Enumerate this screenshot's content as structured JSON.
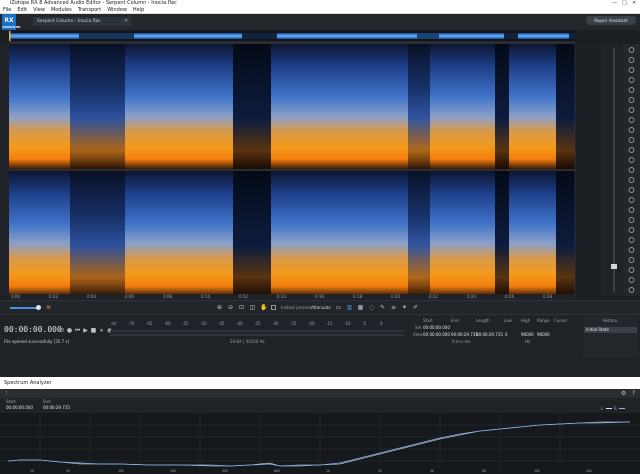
{
  "window": {
    "title": "iZotope RX 8 Advanced Audio Editor - Serpent Column - Inocia.flac",
    "minimize_glyph": "—",
    "maximize_glyph": "□",
    "close_glyph": "✕"
  },
  "menu": [
    "File",
    "Edit",
    "View",
    "Modules",
    "Transport",
    "Window",
    "Help"
  ],
  "logo": {
    "text": "RX",
    "sub": "ADVANCED"
  },
  "file_tab": {
    "label": "Serpent Column - Inocia.flac",
    "close": "✕"
  },
  "repair_assistant": {
    "label": "Repair Assistant"
  },
  "time_ruler": {
    "labels": [
      "0:00",
      "0:02",
      "0:04",
      "0:06",
      "0:08",
      "0:10",
      "0:12",
      "0:14",
      "0:16",
      "0:18",
      "0:20",
      "0:22",
      "0:24",
      "0:26",
      "0:28"
    ]
  },
  "toolbar2": {
    "instant_process": "Instant process",
    "mode": "Attenuate"
  },
  "transport": {
    "time": "00:00:00.000",
    "status": "File opened successfully [35.7 s]",
    "format": "24-bit | 44100 Hz",
    "format_label": "Sample rate",
    "meter_scale": [
      "-Inf",
      "-70",
      "-65",
      "-60",
      "-55",
      "-50",
      "-45",
      "-40",
      "-35",
      "-30",
      "-25",
      "-20",
      "-15",
      "-10",
      "-5",
      "0"
    ],
    "sel_label": "Sel",
    "view_label": "View",
    "start_header": "Start",
    "end_header": "End",
    "length_header": "Length",
    "low_header": "Low",
    "high_header": "High",
    "range_header": "Range",
    "cursor_header": "Cursor",
    "sel_start": "00:00:00.000",
    "view_start": "00:00:00.000",
    "view_end": "00:00:29.735",
    "view_length": "00:00:29.735",
    "low": "0",
    "high": "96000",
    "range": "96000",
    "time_format": "h:m:s.ms",
    "freq_unit": "Hz",
    "history_header": "History",
    "history_item": "Initial State"
  },
  "spectrum_analyzer": {
    "title": "Spectrum Analyzer",
    "start_label": "Start",
    "end_label": "End",
    "start": "00:00:00.000",
    "end": "00:00:29.735",
    "legend_l": "L",
    "legend_r": "R",
    "freq_labels": [
      "20",
      "30",
      "40",
      "50",
      "60",
      "80",
      "100",
      "150",
      "200",
      "300",
      "400",
      "500",
      "600",
      "800",
      "1k",
      "1.5k",
      "2k",
      "3k",
      "4k",
      "5k",
      "6k",
      "8k",
      "10k",
      "15k",
      "20k"
    ]
  },
  "colors": {
    "accent": "#1a6fc4",
    "spectrum_line": "#8ab4e8",
    "status_text": "#c9d1d9"
  }
}
